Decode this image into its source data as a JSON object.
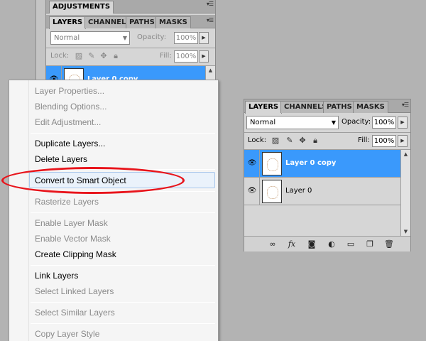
{
  "back_panel": {
    "adjustments_tab": "ADJUSTMENTS",
    "tabs": [
      "LAYERS",
      "CHANNELS",
      "PATHS",
      "MASKS"
    ],
    "blend_mode": "Normal",
    "opacity_label": "Opacity:",
    "opacity_value": "100%",
    "lock_label": "Lock:",
    "fill_label": "Fill:",
    "fill_value": "100%",
    "layer_name": "Layer 0 copy"
  },
  "context_menu": {
    "items": [
      {
        "label": "Layer Properties...",
        "enabled": false
      },
      {
        "label": "Blending Options...",
        "enabled": false
      },
      {
        "label": "Edit Adjustment...",
        "enabled": false
      },
      {
        "label": "Duplicate Layers...",
        "enabled": true
      },
      {
        "label": "Delete Layers",
        "enabled": true
      },
      {
        "label": "Convert to Smart Object",
        "enabled": true,
        "highlighted": true,
        "circled": true
      },
      {
        "label": "Rasterize Layers",
        "enabled": false
      },
      {
        "label": "Enable Layer Mask",
        "enabled": false
      },
      {
        "label": "Enable Vector Mask",
        "enabled": false
      },
      {
        "label": "Create Clipping Mask",
        "enabled": true
      },
      {
        "label": "Link Layers",
        "enabled": true
      },
      {
        "label": "Select Linked Layers",
        "enabled": false
      },
      {
        "label": "Select Similar Layers",
        "enabled": false
      },
      {
        "label": "Copy Layer Style",
        "enabled": false
      }
    ],
    "annotation_color": "#e8141b"
  },
  "layers_panel": {
    "tabs": [
      "LAYERS",
      "CHANNELS",
      "PATHS",
      "MASKS"
    ],
    "blend_mode": "Normal",
    "opacity_label": "Opacity:",
    "opacity_value": "100%",
    "lock_label": "Lock:",
    "fill_label": "Fill:",
    "fill_value": "100%",
    "layers": [
      {
        "name": "Layer 0 copy",
        "selected": true,
        "visible": true
      },
      {
        "name": "Layer 0",
        "selected": false,
        "visible": true
      }
    ],
    "selection_color": "#3a99fc",
    "bottom_icons": [
      "link-icon",
      "fx-icon",
      "mask-icon",
      "adjustment-icon",
      "group-folder-icon",
      "new-layer-icon",
      "trash-icon"
    ]
  }
}
